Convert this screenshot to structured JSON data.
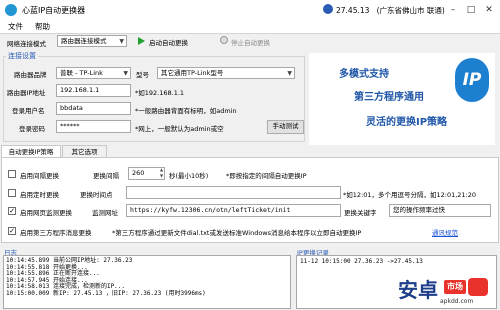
{
  "window": {
    "title": "心蓝IP自动更换器",
    "status": "27.45.13",
    "status_tail": "(广东省佛山市 联通)"
  },
  "menu": [
    "文件",
    "帮助"
  ],
  "toolbar": {
    "mode_label": "网络连接模式",
    "mode_value": "路由器连接模式",
    "start_label": "启动自动更换",
    "stop_label": "停止自动更换"
  },
  "connection": {
    "group_title": "连接设置",
    "brand_label": "路由器品牌",
    "brand_value": "普联 - TP-Link",
    "model_label": "型号",
    "model_value": "其它通用TP-Link型号",
    "ip_label": "路由器IP地址",
    "ip_value": "192.168.1.1",
    "ip_hint": "*如192.168.1.1",
    "user_label": "登录用户名",
    "user_value": "bbdata",
    "user_hint": "*一般路由器背面有标明，如admin",
    "pass_label": "登录密码",
    "pass_value": "******",
    "pass_hint": "*网上，一般默认为admin或空",
    "manual_test": "手动测试"
  },
  "banner": {
    "line1": "多模式支持",
    "line2": "第三方程序通用",
    "line3": "灵活的更换IP策略",
    "logo_text": "IP"
  },
  "tabs": [
    "自动更换IP策略",
    "其它选项"
  ],
  "strategy": {
    "interval_check": "启用间隔更换",
    "interval_label": "更换间隔",
    "interval_value": "260",
    "interval_unit": "秒(最小10秒)",
    "interval_hint": "*即按指定的间隔自动更换IP",
    "timed_check": "启用定时更换",
    "timed_label": "更换时间点",
    "timed_hint": "*如12:01，多个用逗号分隔，如12:01,21:20",
    "monitor_check": "启用网页监测更换",
    "monitor_label": "监测网址",
    "monitor_url": "https://kyfw.12306.cn/otn/leftTicket/init",
    "keyword_label": "更换关键字",
    "keyword_value": "您的操作频率过快",
    "third_check": "启用第三方程序消息更换",
    "third_hint": "*第三方程序通过更新文件dial.txt或发送标准Windows消息给本程序以立即自动更换IP",
    "third_link": "通讯规范"
  },
  "log": {
    "title": "日志",
    "lines": [
      "10:14:45.899  当前公网IP地址: 27.36.23",
      "10:14:55.818  开始更换...",
      "10:14:55.896  正在断开连接...",
      "10:14:57.945  开始连接...",
      "10:14:58.013  连接完成，检测新的IP...",
      "10:15:00.009  新IP: 27.45.13     ，旧IP: 27.36.23     (用时3996ms)"
    ]
  },
  "history": {
    "title": "IP更换记录",
    "lines": [
      "11-12 10:15:00  27.36.23     ->27.45.13"
    ]
  },
  "watermark": {
    "text": "安卓",
    "badge": "市场",
    "domain": "apkdd.com"
  },
  "colors": {
    "accent": "#2a5bb5",
    "logo": "#1d7fd0",
    "link": "#1a4fd8"
  }
}
